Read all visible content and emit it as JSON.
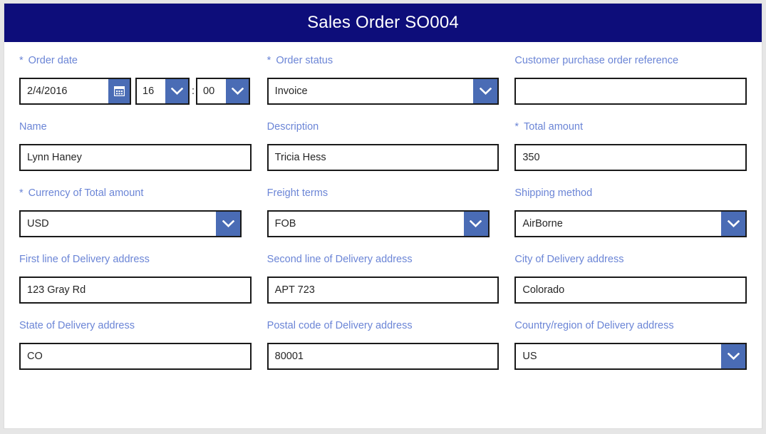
{
  "header": {
    "title": "Sales Order SO004"
  },
  "theme": {
    "header_bg": "#0d0d7a",
    "label_blue": "#6b85d6",
    "control_blue": "#4a6cb5",
    "border_black": "#1a1a1a",
    "page_bg": "#e6e6e6",
    "card_bg": "#ffffff"
  },
  "icons": {
    "calendar": "calendar-icon",
    "chevron_down": "chevron-down-icon"
  },
  "form": {
    "order_date": {
      "label": "Order date",
      "required": true,
      "date_value": "2/4/2016",
      "hour_value": "16",
      "separator": ":",
      "minute_value": "00"
    },
    "order_status": {
      "label": "Order status",
      "required": true,
      "value": "Invoice"
    },
    "customer_po_reference": {
      "label": "Customer purchase order reference",
      "required": false,
      "value": "",
      "placeholder": ""
    },
    "name": {
      "label": "Name",
      "required": false,
      "value": "Lynn Haney"
    },
    "description": {
      "label": "Description",
      "required": false,
      "value": "Tricia Hess"
    },
    "total_amount": {
      "label": "Total amount",
      "required": true,
      "value": "350"
    },
    "currency": {
      "label": "Currency of Total amount",
      "required": true,
      "value": "USD"
    },
    "freight_terms": {
      "label": "Freight terms",
      "required": false,
      "value": "FOB"
    },
    "shipping_method": {
      "label": "Shipping method",
      "required": false,
      "value": "AirBorne"
    },
    "delivery_line1": {
      "label": "First line of Delivery address",
      "required": false,
      "value": "123 Gray Rd"
    },
    "delivery_line2": {
      "label": "Second line of Delivery address",
      "required": false,
      "value": "APT 723"
    },
    "delivery_city": {
      "label": "City of Delivery address",
      "required": false,
      "value": "Colorado"
    },
    "delivery_state": {
      "label": "State of Delivery address",
      "required": false,
      "value": "CO"
    },
    "delivery_postal": {
      "label": "Postal code of Delivery address",
      "required": false,
      "value": "80001"
    },
    "delivery_country": {
      "label": "Country/region of Delivery address",
      "required": false,
      "value": "US"
    }
  },
  "required_marker": "*"
}
